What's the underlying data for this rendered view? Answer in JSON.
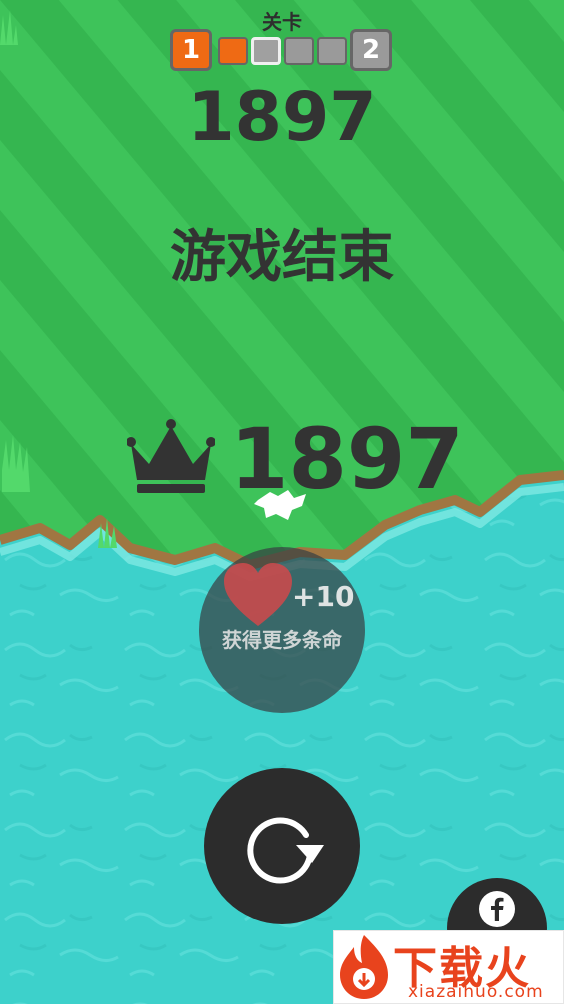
{
  "level": {
    "label": "关卡",
    "current": "1",
    "next": "2",
    "segments_filled": 1,
    "segments_total": 4
  },
  "score": "1897",
  "game_over_text": "游戏结束",
  "best_score": "1897",
  "extra_lives": {
    "bonus": "+10",
    "text": "获得更多条命"
  },
  "watermark": {
    "title": "下载火",
    "url": "xiazaihuo.com"
  },
  "icons": [
    "crown-icon",
    "heart-icon",
    "restart-icon",
    "facebook-icon",
    "fire-logo-icon"
  ],
  "colors": {
    "grass": "#3ec35a",
    "grass_stripe": "#33b04d",
    "shore": "#a07642",
    "water": "#3dd1cb",
    "accent_orange": "#ef6a14",
    "locked_gray": "#9a9a9a",
    "text_dark": "#333333",
    "button_dark": "#2c2c2c",
    "heart": "#c94a4d"
  }
}
